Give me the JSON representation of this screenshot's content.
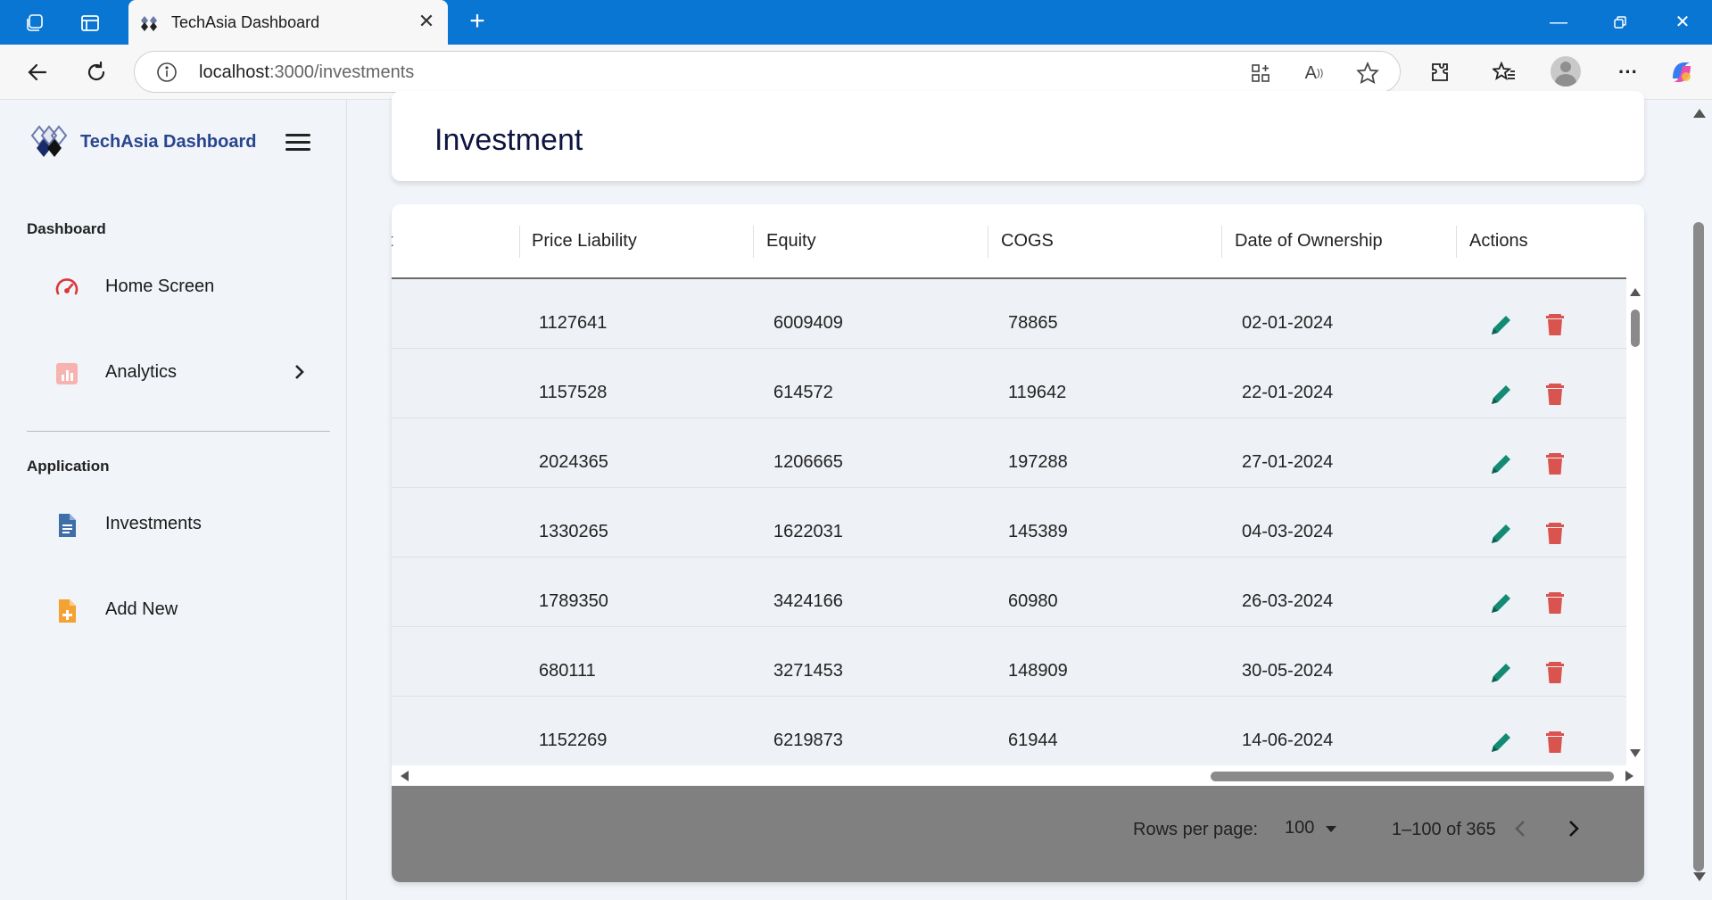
{
  "browser": {
    "tab_title": "TechAsia Dashboard",
    "url_host": "localhost",
    "url_path": ":3000/investments"
  },
  "sidebar": {
    "brand": "TechAsia Dashboard",
    "section_dashboard": "Dashboard",
    "section_application": "Application",
    "items": [
      {
        "label": "Home Screen",
        "icon": "speedometer-icon"
      },
      {
        "label": "Analytics",
        "icon": "bar-chart-icon"
      },
      {
        "label": "Investments",
        "icon": "document-icon"
      },
      {
        "label": "Add New",
        "icon": "add-file-icon"
      }
    ]
  },
  "main": {
    "title": "Investment",
    "table": {
      "columns": [
        "t",
        "Price Liability",
        "Equity",
        "COGS",
        "Date of Ownership",
        "Actions"
      ],
      "rows": [
        {
          "price_liability": "1127641",
          "equity": "6009409",
          "cogs": "78865",
          "date": "02-01-2024"
        },
        {
          "price_liability": "1157528",
          "equity": "614572",
          "cogs": "119642",
          "date": "22-01-2024"
        },
        {
          "price_liability": "2024365",
          "equity": "1206665",
          "cogs": "197288",
          "date": "27-01-2024"
        },
        {
          "price_liability": "1330265",
          "equity": "1622031",
          "cogs": "145389",
          "date": "04-03-2024"
        },
        {
          "price_liability": "1789350",
          "equity": "3424166",
          "cogs": "60980",
          "date": "26-03-2024"
        },
        {
          "price_liability": "680111",
          "equity": "3271453",
          "cogs": "148909",
          "date": "30-05-2024"
        },
        {
          "price_liability": "1152269",
          "equity": "6219873",
          "cogs": "61944",
          "date": "14-06-2024"
        }
      ]
    },
    "pagination": {
      "rows_per_page_label": "Rows per page:",
      "rows_per_page_value": "100",
      "range": "1–100 of 365"
    }
  },
  "colors": {
    "brand_blue": "#28458f",
    "edit_green": "#138a74",
    "delete_red": "#d9534f",
    "titlebar": "#0a76d4"
  }
}
